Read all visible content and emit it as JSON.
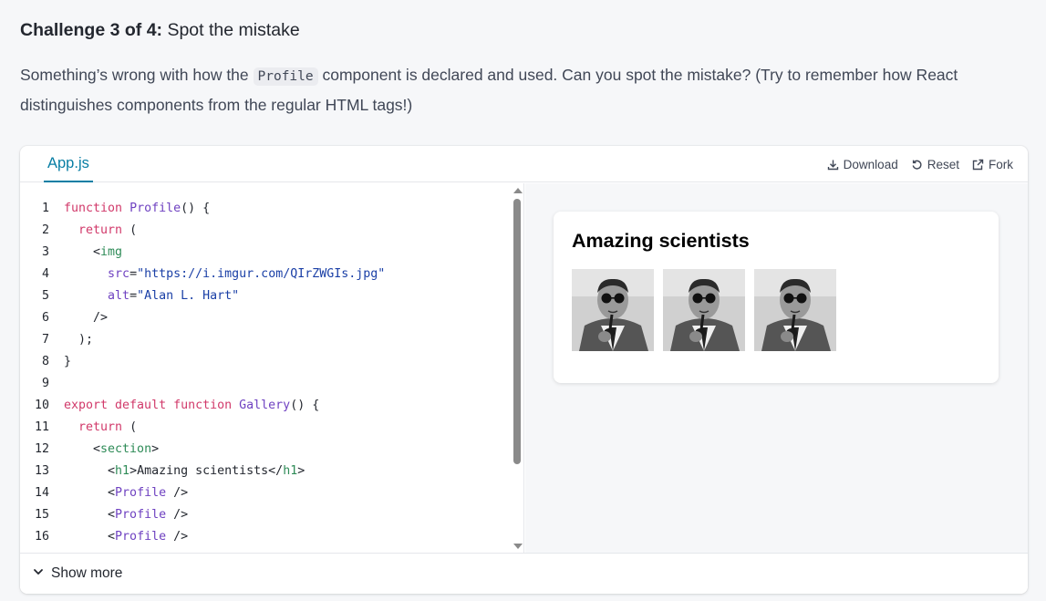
{
  "challenge": {
    "counter": "Challenge 3 of 4:",
    "title": "Spot the mistake"
  },
  "description": {
    "before": "Something’s wrong with how the ",
    "code": "Profile",
    "after": " component is declared and used. Can you spot the mistake? (Try to remember how React distinguishes components from the regular HTML tags!)"
  },
  "sandbox": {
    "tab_label": "App.js",
    "actions": {
      "download": "Download",
      "reset": "Reset",
      "fork": "Fork"
    },
    "show_more": "Show more"
  },
  "code_lines": [
    {
      "n": "1",
      "tokens": [
        [
          "kw",
          "function "
        ],
        [
          "fn",
          "Profile"
        ],
        [
          "punct",
          "() {"
        ]
      ]
    },
    {
      "n": "2",
      "tokens": [
        [
          "punct",
          "  "
        ],
        [
          "kw",
          "return"
        ],
        [
          "punct",
          " ("
        ]
      ]
    },
    {
      "n": "3",
      "tokens": [
        [
          "punct",
          "    <"
        ],
        [
          "tag",
          "img"
        ]
      ]
    },
    {
      "n": "4",
      "tokens": [
        [
          "punct",
          "      "
        ],
        [
          "attr",
          "src"
        ],
        [
          "punct",
          "="
        ],
        [
          "str",
          "\"https://i.imgur.com/QIrZWGIs.jpg\""
        ]
      ]
    },
    {
      "n": "5",
      "tokens": [
        [
          "punct",
          "      "
        ],
        [
          "attr",
          "alt"
        ],
        [
          "punct",
          "="
        ],
        [
          "str",
          "\"Alan L. Hart\""
        ]
      ]
    },
    {
      "n": "6",
      "tokens": [
        [
          "punct",
          "    />"
        ]
      ]
    },
    {
      "n": "7",
      "tokens": [
        [
          "punct",
          "  );"
        ]
      ]
    },
    {
      "n": "8",
      "tokens": [
        [
          "punct",
          "}"
        ]
      ]
    },
    {
      "n": "9",
      "tokens": []
    },
    {
      "n": "10",
      "tokens": [
        [
          "kw",
          "export default function "
        ],
        [
          "fn",
          "Gallery"
        ],
        [
          "punct",
          "() {"
        ]
      ]
    },
    {
      "n": "11",
      "tokens": [
        [
          "punct",
          "  "
        ],
        [
          "kw",
          "return"
        ],
        [
          "punct",
          " ("
        ]
      ]
    },
    {
      "n": "12",
      "tokens": [
        [
          "punct",
          "    <"
        ],
        [
          "tag",
          "section"
        ],
        [
          "punct",
          ">"
        ]
      ]
    },
    {
      "n": "13",
      "tokens": [
        [
          "punct",
          "      <"
        ],
        [
          "tag",
          "h1"
        ],
        [
          "punct",
          ">Amazing scientists</"
        ],
        [
          "tag",
          "h1"
        ],
        [
          "punct",
          ">"
        ]
      ]
    },
    {
      "n": "14",
      "tokens": [
        [
          "punct",
          "      <"
        ],
        [
          "fn",
          "Profile"
        ],
        [
          "punct",
          " />"
        ]
      ]
    },
    {
      "n": "15",
      "tokens": [
        [
          "punct",
          "      <"
        ],
        [
          "fn",
          "Profile"
        ],
        [
          "punct",
          " />"
        ]
      ]
    },
    {
      "n": "16",
      "tokens": [
        [
          "punct",
          "      <"
        ],
        [
          "fn",
          "Profile"
        ],
        [
          "punct",
          " />"
        ]
      ]
    }
  ],
  "preview": {
    "heading": "Amazing scientists",
    "images": [
      {
        "alt": "Alan L. Hart"
      },
      {
        "alt": "Alan L. Hart"
      },
      {
        "alt": "Alan L. Hart"
      }
    ]
  },
  "colors": {
    "accent": "#087ea4",
    "keyword": "#d1396a",
    "function": "#6f42c1",
    "tag": "#2e8b57",
    "string": "#1a3fa6"
  }
}
